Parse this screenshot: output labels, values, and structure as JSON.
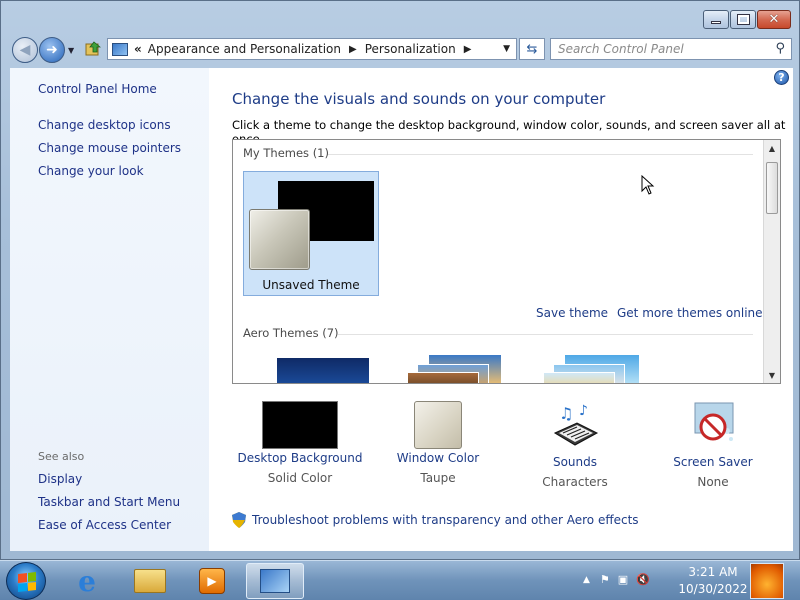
{
  "window": {
    "minimize": "minimize",
    "maximize": "maximize",
    "close": "close"
  },
  "addressbar": {
    "path": [
      "Appearance and Personalization",
      "Personalization"
    ],
    "overflow_chevron": "«"
  },
  "search": {
    "placeholder": "Search Control Panel"
  },
  "sidebar": {
    "items": [
      {
        "label": "Control Panel Home"
      },
      {
        "label": "Change desktop icons"
      },
      {
        "label": "Change mouse pointers"
      },
      {
        "label": "Change your look"
      }
    ],
    "see_also_heading": "See also",
    "see_also": [
      {
        "label": "Display"
      },
      {
        "label": "Taskbar and Start Menu"
      },
      {
        "label": "Ease of Access Center"
      }
    ]
  },
  "main": {
    "title": "Change the visuals and sounds on your computer",
    "subtitle": "Click a theme to change the desktop background, window color, sounds, and screen saver all at once.",
    "my_themes_label": "My Themes (1)",
    "selected_theme": "Unsaved Theme",
    "save_theme": "Save theme",
    "get_more": "Get more themes online",
    "aero_label": "Aero Themes (7)",
    "settings": [
      {
        "label": "Desktop Background",
        "value": "Solid Color"
      },
      {
        "label": "Window Color",
        "value": "Taupe"
      },
      {
        "label": "Sounds",
        "value": "Characters"
      },
      {
        "label": "Screen Saver",
        "value": "None"
      }
    ],
    "troubleshoot": "Troubleshoot problems with transparency and other Aero effects"
  },
  "taskbar": {
    "time": "3:21 AM",
    "date": "10/30/2022"
  },
  "colors": {
    "link": "#1e3c87",
    "selected_tile": "#cde3f9"
  }
}
